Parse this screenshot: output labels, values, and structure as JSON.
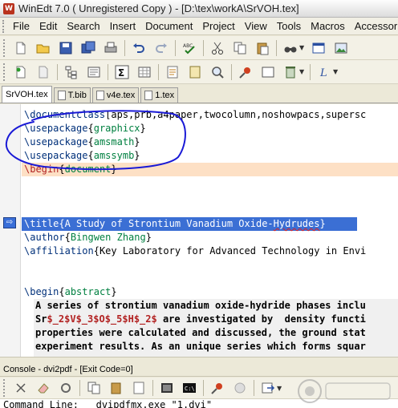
{
  "window": {
    "title": "WinEdt 7.0  ( Unregistered  Copy )  -  [D:\\tex\\workA\\SrVOH.tex]",
    "logo_letter": "W"
  },
  "menu": [
    "File",
    "Edit",
    "Search",
    "Insert",
    "Document",
    "Project",
    "View",
    "Tools",
    "Macros",
    "Accessories"
  ],
  "toolbar1": [
    "new-document-icon",
    "open-folder-icon",
    "save-icon",
    "save-all-icon",
    "print-icon",
    "undo-icon",
    "redo-icon",
    "spell-check-icon",
    "cut-icon",
    "copy-icon",
    "paste-icon",
    "find-icon",
    "window-icon",
    "image-icon"
  ],
  "toolbar2": [
    "new-tex-icon",
    "template-icon",
    "tree-icon",
    "project-icon",
    "sigma-icon",
    "table-icon",
    "format-icon",
    "macro-icon",
    "search-files-icon",
    "bullet-icon",
    "clear-icon",
    "trash-icon",
    "latex-icon"
  ],
  "tabs": [
    {
      "label": "SrVOH.tex",
      "active": true
    },
    {
      "label": "T.bib",
      "active": false
    },
    {
      "label": "v4e.tex",
      "active": false
    },
    {
      "label": "1.tex",
      "active": false
    }
  ],
  "editor": {
    "line1": {
      "cmd": "\\documentclass",
      "rest": "[aps,prb,a4paper,twocolumn,noshowpacs,supersc"
    },
    "line2": {
      "cmd": "\\usepackage",
      "open": "{",
      "arg": "graphicx",
      "close": "}"
    },
    "line3": {
      "cmd": "\\usepackage",
      "open": "{",
      "arg": "amsmath",
      "close": "}"
    },
    "line4": {
      "cmd": "\\usepackage",
      "open": "{",
      "arg": "amssymb",
      "close": "}"
    },
    "line5": {
      "cmd": "\\begin",
      "open": "{",
      "arg": "document",
      "close": "}"
    },
    "line6": {
      "text": "\\title{A Study of Strontium Vanadium Oxide-Hydrudes}"
    },
    "line7": {
      "cmd": "\\author",
      "open": "{",
      "arg": "Bingwen Zhang",
      "close": "}"
    },
    "line8": {
      "cmd": "\\affiliation",
      "open": "{",
      "arg": "Key Laboratory for Advanced Technology in Envi"
    },
    "line9": {
      "cmd": "\\begin",
      "open": "{",
      "arg": "abstract",
      "close": "}"
    },
    "abstract": [
      "A series of strontium vanadium oxide-hydride phases inclu",
      "Sr$_2$V$_3$O$_5$H$_2$ are investigated by  density functi",
      "properties were calculated and discussed, the ground stat",
      "experiment results. As an unique series which forms squar"
    ],
    "abstract_math": "$_2$V$_3$O$_5$H$_2$",
    "abstract_line2_prefix": "Sr",
    "abstract_line2_suffix": " are investigated by  density functi"
  },
  "console": {
    "header": "Console - dvi2pdf - [Exit Code=0]",
    "output": "Command Line:   dvipdfmx.exe \"1.dvi\""
  },
  "colors": {
    "command": "#00307a",
    "argument": "#008040",
    "math": "#b22222",
    "selection": "#3b6fd4",
    "current_line": "#fde0c5",
    "annotation_ink": "#1a1ad6"
  }
}
